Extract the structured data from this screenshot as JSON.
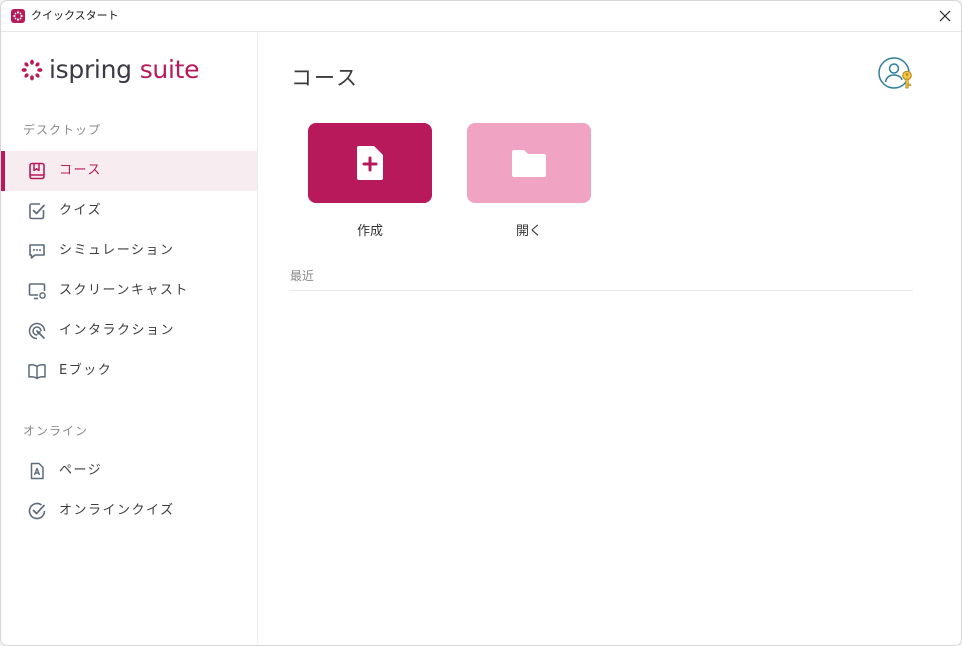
{
  "window": {
    "title": "クイックスタート"
  },
  "brand": {
    "logo_word1": "ispring",
    "logo_word2": "suite",
    "accent_color": "#b8195a",
    "accent_light": "#f0a3c3"
  },
  "sidebar": {
    "desktop_section": "デスクトップ",
    "desktop_items": [
      {
        "label": "コース",
        "icon": "course-book-icon",
        "active": true
      },
      {
        "label": "クイズ",
        "icon": "quiz-check-icon",
        "active": false
      },
      {
        "label": "シミュレーション",
        "icon": "simulation-chat-icon",
        "active": false
      },
      {
        "label": "スクリーンキャスト",
        "icon": "screencast-monitor-icon",
        "active": false
      },
      {
        "label": "インタラクション",
        "icon": "interaction-touch-icon",
        "active": false
      },
      {
        "label": "Eブック",
        "icon": "ebook-open-book-icon",
        "active": false
      }
    ],
    "online_section": "オンライン",
    "online_items": [
      {
        "label": "ページ",
        "icon": "page-document-icon",
        "active": false
      },
      {
        "label": "オンラインクイズ",
        "icon": "online-quiz-check-icon",
        "active": false
      }
    ]
  },
  "main": {
    "title": "コース",
    "actions": [
      {
        "label": "作成",
        "icon": "new-file-plus-icon"
      },
      {
        "label": "開く",
        "icon": "folder-icon"
      }
    ],
    "recent_label": "最近",
    "account_icon": "account-key-icon"
  }
}
